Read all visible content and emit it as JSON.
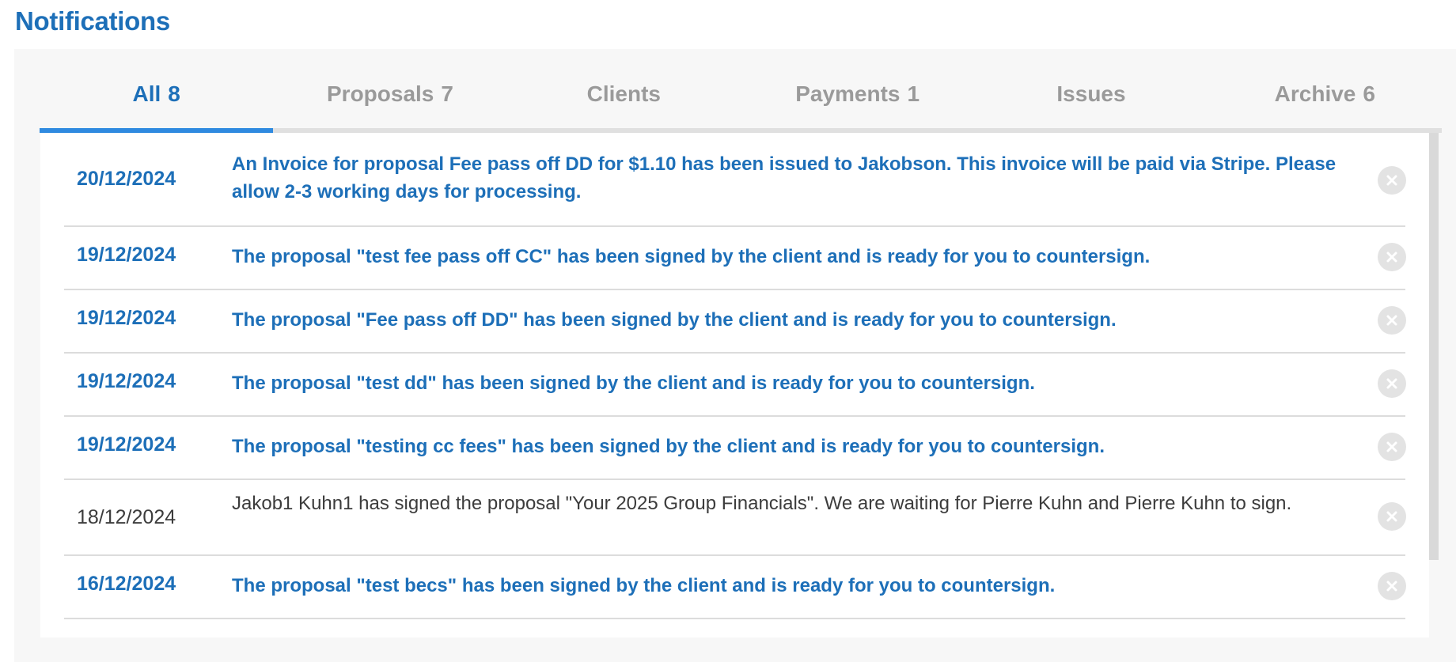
{
  "page": {
    "title": "Notifications"
  },
  "colors": {
    "accent": "#1d6fb8",
    "tab_indicator": "#2f8ae0",
    "inactive_tab": "#9a9a9a",
    "read_text": "#3c3c3c",
    "close_circle": "#e3e3e3"
  },
  "tabs": [
    {
      "label": "All",
      "count": "8",
      "active": true
    },
    {
      "label": "Proposals",
      "count": "7",
      "active": false
    },
    {
      "label": "Clients",
      "count": "",
      "active": false
    },
    {
      "label": "Payments",
      "count": "1",
      "active": false
    },
    {
      "label": "Issues",
      "count": "",
      "active": false
    },
    {
      "label": "Archive",
      "count": "6",
      "active": false
    }
  ],
  "notifications": [
    {
      "date": "20/12/2024",
      "message": "An Invoice for proposal Fee pass off DD for $1.10 has been issued to Jakobson. This invoice will be paid via Stripe. Please allow 2-3 working days for processing.",
      "unread": true,
      "close_icon": "close-circle-icon"
    },
    {
      "date": "19/12/2024",
      "message": "The proposal \"test fee pass off CC\" has been signed by the client and is ready for you to countersign.",
      "unread": true,
      "close_icon": "close-circle-icon"
    },
    {
      "date": "19/12/2024",
      "message": "The proposal \"Fee pass off DD\" has been signed by the client and is ready for you to countersign.",
      "unread": true,
      "close_icon": "close-circle-icon"
    },
    {
      "date": "19/12/2024",
      "message": "The proposal \"test dd\" has been signed by the client and is ready for you to countersign.",
      "unread": true,
      "close_icon": "close-circle-icon"
    },
    {
      "date": "19/12/2024",
      "message": "The proposal \"testing cc fees\" has been signed by the client and is ready for you to countersign.",
      "unread": true,
      "close_icon": "close-circle-icon"
    },
    {
      "date": "18/12/2024",
      "message": "Jakob1 Kuhn1 has signed the proposal \"Your 2025 Group Financials\". We are waiting for Pierre Kuhn and Pierre Kuhn to sign.",
      "unread": false,
      "close_icon": "close-circle-icon"
    },
    {
      "date": "16/12/2024",
      "message": "The proposal \"test becs\" has been signed by the client and is ready for you to countersign.",
      "unread": true,
      "close_icon": "close-circle-icon"
    }
  ]
}
